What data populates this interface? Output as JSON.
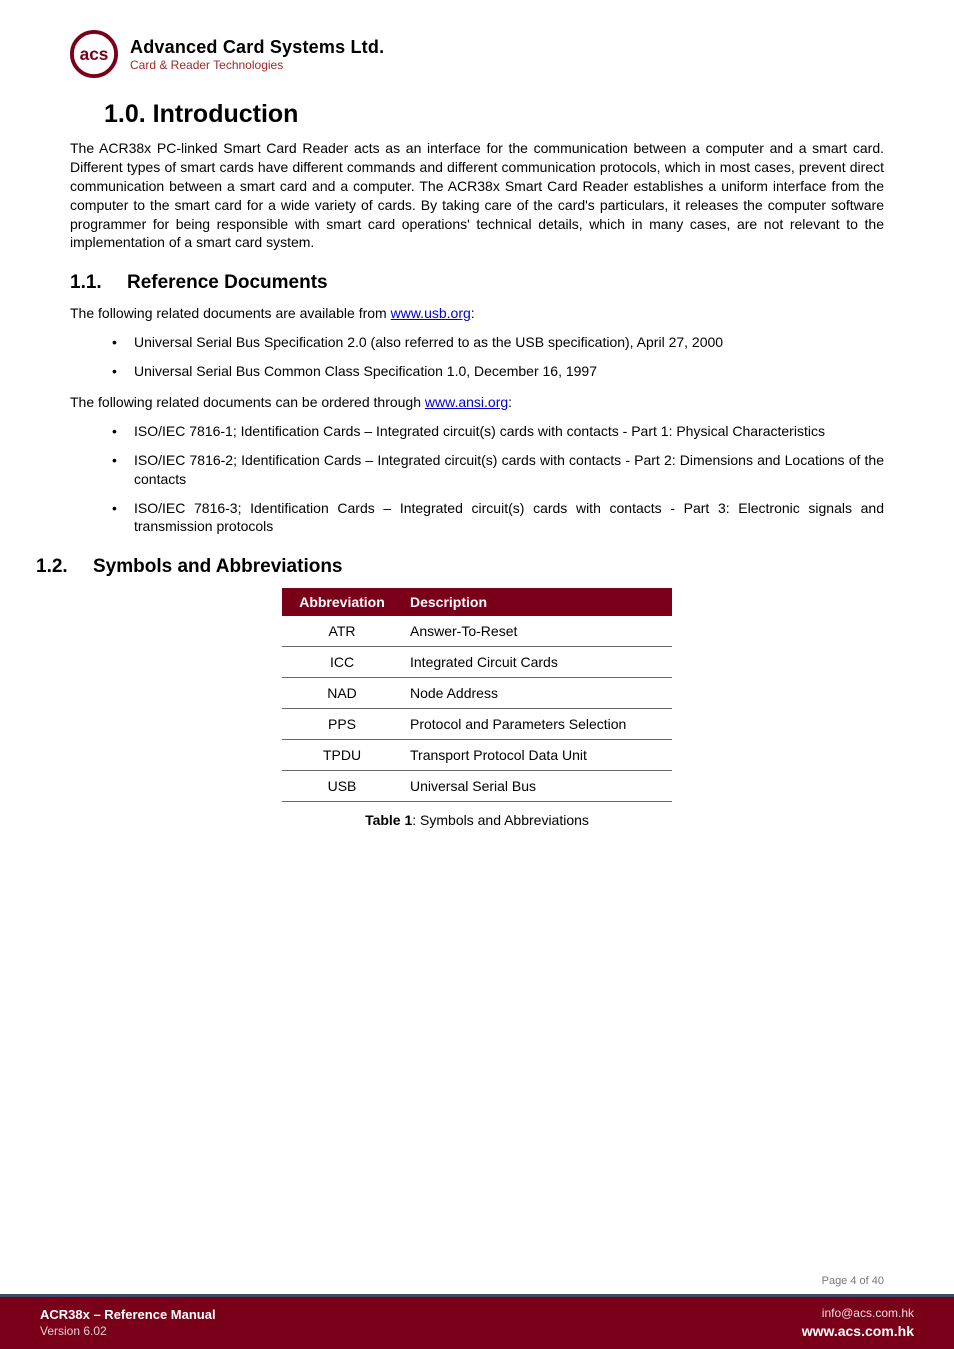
{
  "logo": {
    "company_name": "Advanced Card Systems Ltd.",
    "tagline": "Card & Reader Technologies"
  },
  "section": {
    "number": "1.0.",
    "title": "Introduction",
    "intro": "The ACR38x PC-linked Smart Card Reader acts as an interface for the communication between a computer and a smart card. Different types of smart cards have different commands and different communication protocols, which in most cases, prevent direct communication between a smart card and a computer. The ACR38x Smart Card Reader establishes a uniform interface from the computer to the smart card for a wide variety of cards. By taking care of the card's particulars, it releases the computer software programmer for being responsible with smart card operations' technical details, which in many cases, are not relevant to the implementation of a smart card system."
  },
  "sub1": {
    "number": "1.1.",
    "title": "Reference Documents",
    "lead1_pre": "The following related documents are available from ",
    "lead1_link": "www.usb.org",
    "lead1_post": ":",
    "bullets1": [
      "Universal Serial Bus Specification 2.0 (also referred to as the USB specification), April 27, 2000",
      "Universal Serial Bus Common Class Specification 1.0, December 16, 1997"
    ],
    "lead2_pre": "The following related documents can be ordered through ",
    "lead2_link": "www.ansi.org",
    "lead2_post": ":",
    "bullets2": [
      "ISO/IEC 7816-1; Identification Cards – Integrated circuit(s) cards with contacts - Part 1: Physical Characteristics",
      "ISO/IEC 7816-2; Identification Cards – Integrated circuit(s) cards with contacts - Part 2: Dimensions and Locations of the contacts",
      "ISO/IEC 7816-3; Identification Cards – Integrated circuit(s) cards with contacts - Part 3: Electronic signals and transmission protocols"
    ]
  },
  "sub2": {
    "number": "1.2.",
    "title": "Symbols and Abbreviations",
    "table": {
      "head": {
        "c1": "Abbreviation",
        "c2": "Description"
      },
      "rows": [
        {
          "c1": "ATR",
          "c2": "Answer-To-Reset"
        },
        {
          "c1": "ICC",
          "c2": "Integrated Circuit Cards"
        },
        {
          "c1": "NAD",
          "c2": "Node Address"
        },
        {
          "c1": "PPS",
          "c2": "Protocol and Parameters Selection"
        },
        {
          "c1": "TPDU",
          "c2": "Transport Protocol Data Unit"
        },
        {
          "c1": "USB",
          "c2": "Universal Serial Bus"
        }
      ],
      "caption_bold": "Table 1",
      "caption_rest": ": Symbols and Abbreviations"
    }
  },
  "page_number": "Page 4 of 40",
  "footer": {
    "doc_title_bold": "ACR38x – Reference Manual",
    "version": "Version 6.02",
    "email": "info@acs.com.hk",
    "site": "www.acs.com.hk"
  }
}
